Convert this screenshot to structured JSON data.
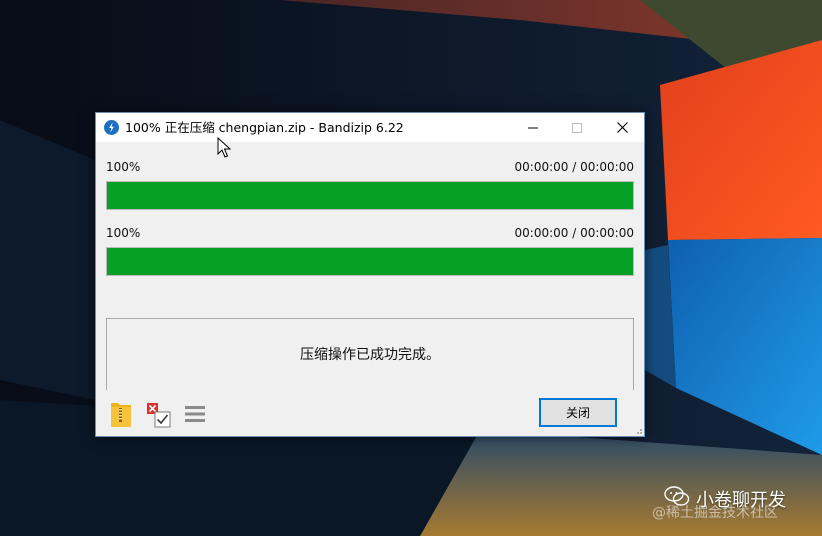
{
  "window": {
    "title": "100% 正在压缩 chengpian.zip - Bandizip 6.22",
    "controls": {
      "minimize": "minimize",
      "maximize": "maximize",
      "close": "close"
    }
  },
  "progress": [
    {
      "percent_label": "100%",
      "time_label": "00:00:00 / 00:00:00",
      "fraction": 1.0
    },
    {
      "percent_label": "100%",
      "time_label": "00:00:00 / 00:00:00",
      "fraction": 1.0
    }
  ],
  "message": "压缩操作已成功完成。",
  "toolbar": {
    "icons": [
      "folder-zip-icon",
      "checklist-icon",
      "hamburger-menu-icon"
    ]
  },
  "buttons": {
    "close_label": "关闭"
  },
  "watermark": {
    "main": "小卷聊开发",
    "sub": "@稀土掘金技术社区"
  },
  "colors": {
    "progress_fill": "#06a026",
    "accent_border": "#0078d7",
    "wallpaper_red": "#f0481a",
    "wallpaper_blue": "#1a8ee0"
  }
}
